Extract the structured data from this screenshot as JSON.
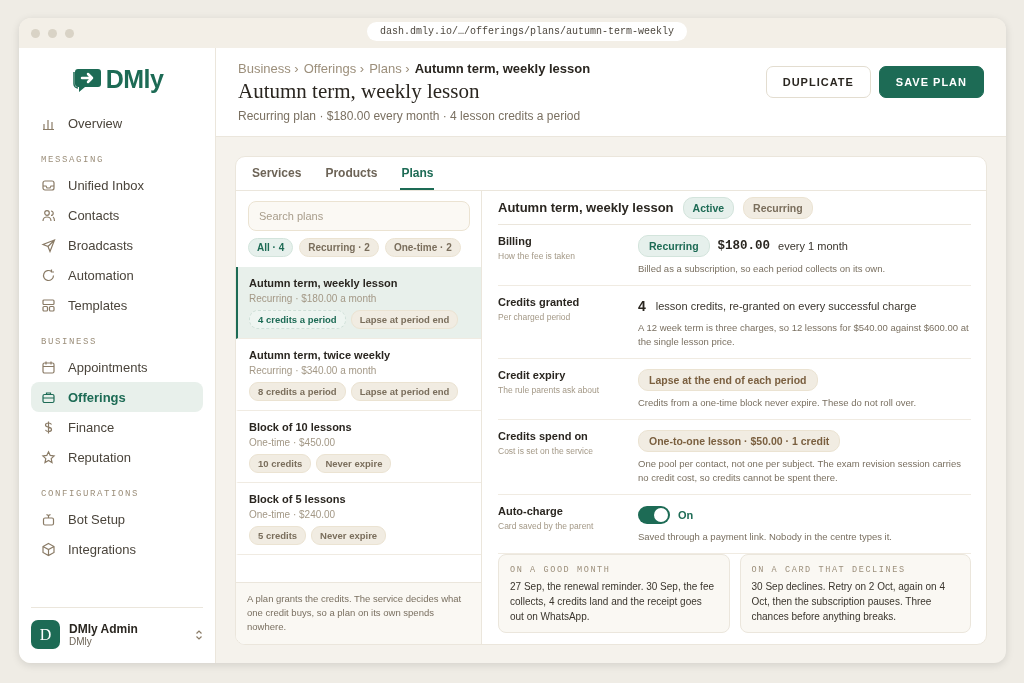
{
  "browser": {
    "url": "dash.dmly.io/…/offerings/plans/autumn-term-weekly"
  },
  "sidebar": {
    "logo": "DMly",
    "sections": [
      {
        "items": [
          {
            "label": "Overview",
            "selected": false
          }
        ]
      },
      {
        "title": "MESSAGING",
        "items": [
          {
            "label": "Unified Inbox",
            "selected": false
          },
          {
            "label": "Contacts",
            "selected": false
          },
          {
            "label": "Broadcasts",
            "selected": false
          },
          {
            "label": "Automation",
            "selected": false
          },
          {
            "label": "Templates",
            "selected": false
          }
        ]
      },
      {
        "title": "BUSINESS",
        "items": [
          {
            "label": "Appointments",
            "selected": false
          },
          {
            "label": "Offerings",
            "selected": true
          },
          {
            "label": "Finance",
            "selected": false
          },
          {
            "label": "Reputation",
            "selected": false
          }
        ]
      },
      {
        "title": "CONFIGURATIONS",
        "items": [
          {
            "label": "Bot Setup",
            "selected": false
          },
          {
            "label": "Integrations",
            "selected": false
          }
        ]
      }
    ],
    "user": {
      "initial": "D",
      "name": "DMly Admin",
      "org": "DMly"
    }
  },
  "header": {
    "breadcrumb": [
      "Business ›",
      "Offerings ›",
      "Plans ›"
    ],
    "current": "Autumn term, weekly lesson",
    "title": "Autumn term, weekly lesson",
    "subtitle": "Recurring plan · $180.00 every month · 4 lesson credits a period",
    "buttons": [
      {
        "label": "DUPLICATE",
        "kind": "secondary"
      },
      {
        "label": "SAVE PLAN",
        "kind": "primary"
      }
    ]
  },
  "tabs": [
    {
      "label": "Services",
      "selected": false
    },
    {
      "label": "Products",
      "selected": false
    },
    {
      "label": "Plans",
      "selected": true
    }
  ],
  "plan_list": {
    "search": {
      "placeholder": "Search plans"
    },
    "filters": [
      {
        "label": "All · 4",
        "selected": true
      },
      {
        "label": "Recurring · 2",
        "selected": false
      },
      {
        "label": "One-time · 2",
        "selected": false
      }
    ],
    "plans": [
      {
        "name": "Autumn term, weekly lesson",
        "meta": "Recurring · $180.00 a month",
        "tags": [
          "4 credits a period",
          "Lapse at period end"
        ],
        "selected": true
      },
      {
        "name": "Autumn term, twice weekly",
        "meta": "Recurring · $340.00 a month",
        "tags": [
          "8 credits a period",
          "Lapse at period end"
        ],
        "selected": false
      },
      {
        "name": "Block of 10 lessons",
        "meta": "One-time · $450.00",
        "tags": [
          "10 credits",
          "Never expire"
        ],
        "selected": false
      },
      {
        "name": "Block of 5 lessons",
        "meta": "One-time · $240.00",
        "tags": [
          "5 credits",
          "Never expire"
        ],
        "selected": false
      }
    ],
    "footnote": "A plan grants the credits. The service decides what one credit buys, so a plan on its own spends nowhere."
  },
  "detail": {
    "title": "Autumn term, weekly lesson",
    "badges": [
      {
        "label": "Active",
        "kind": "status"
      },
      {
        "label": "Recurring",
        "kind": "plain"
      }
    ],
    "rows": [
      {
        "kind": "billing",
        "label": "Billing",
        "hint": "How the fee is taken",
        "pill": "Recurring",
        "price": "$180.00",
        "period": "every 1 month",
        "note": "Billed as a subscription, so each period collects on its own."
      },
      {
        "kind": "credits",
        "label": "Credits granted",
        "hint": "Per charged period",
        "number": "4",
        "text": "lesson credits, re-granted on every successful charge",
        "note": "A 12 week term is three charges, so 12 lessons for $540.00 against $600.00 at the single lesson price."
      },
      {
        "kind": "pill",
        "label": "Credit expiry",
        "hint": "The rule parents ask about",
        "pill": "Lapse at the end of each period",
        "note": "Credits from a one-time block never expire. These do not roll over."
      },
      {
        "kind": "pill",
        "label": "Credits spend on",
        "hint": "Cost is set on the service",
        "pill": "One-to-one lesson · $50.00 · 1 credit",
        "note": "One pool per contact, not one per subject. The exam revision session carries no credit cost, so credits cannot be spent there."
      },
      {
        "kind": "toggle",
        "label": "Auto-charge",
        "hint": "Card saved by the parent",
        "on": true,
        "state_label": "On",
        "note": "Saved through a payment link. Nobody in the centre types it."
      }
    ],
    "scenarios": [
      {
        "title": "ON A GOOD MONTH",
        "body": "27 Sep, the renewal reminder. 30 Sep, the fee collects, 4 credits land and the receipt goes out on WhatsApp."
      },
      {
        "title": "ON A CARD THAT DECLINES",
        "body": "30 Sep declines. Retry on 2 Oct, again on 4 Oct, then the subscription pauses. Three chances before anything breaks."
      }
    ]
  }
}
